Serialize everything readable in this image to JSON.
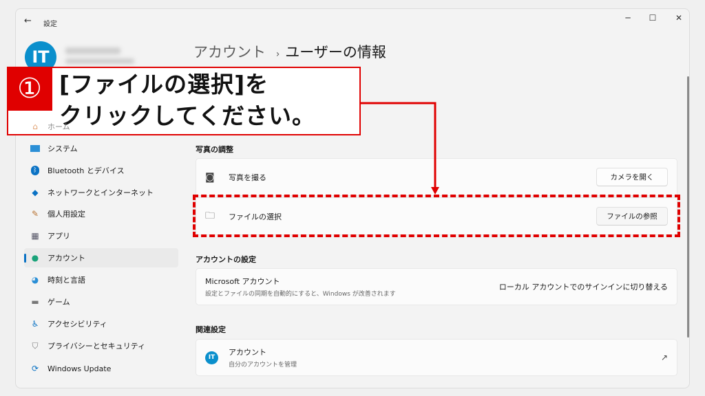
{
  "window": {
    "title": "設定",
    "back_icon": "arrow-left-icon",
    "controls": [
      "minimize",
      "maximize",
      "close"
    ]
  },
  "user": {
    "avatar_text": "IT",
    "avatar_color": "#0a8fcc"
  },
  "sidebar": {
    "items": [
      {
        "label": "ホーム",
        "icon": "home-icon"
      },
      {
        "label": "システム",
        "icon": "monitor-icon"
      },
      {
        "label": "Bluetooth とデバイス",
        "icon": "bluetooth-icon"
      },
      {
        "label": "ネットワークとインターネット",
        "icon": "wifi-icon"
      },
      {
        "label": "個人用設定",
        "icon": "brush-icon"
      },
      {
        "label": "アプリ",
        "icon": "apps-icon"
      },
      {
        "label": "アカウント",
        "icon": "person-icon",
        "selected": true
      },
      {
        "label": "時刻と言語",
        "icon": "globe-clock-icon"
      },
      {
        "label": "ゲーム",
        "icon": "gamepad-icon"
      },
      {
        "label": "アクセシビリティ",
        "icon": "accessibility-icon"
      },
      {
        "label": "プライバシーとセキュリティ",
        "icon": "shield-icon"
      },
      {
        "label": "Windows Update",
        "icon": "update-icon"
      }
    ]
  },
  "main": {
    "breadcrumb": {
      "parent": "アカウント",
      "separator": "›",
      "current": "ユーザーの情報"
    },
    "photo_section": {
      "title": "写真の調整",
      "rows": [
        {
          "label": "写真を撮る",
          "icon": "camera-icon",
          "button": "カメラを開く"
        },
        {
          "label": "ファイルの選択",
          "icon": "folder-icon",
          "button": "ファイルの参照"
        }
      ]
    },
    "account_section": {
      "title": "アカウントの設定",
      "row": {
        "label": "Microsoft アカウント",
        "description": "設定とファイルの同期を自動的にすると、Windows が改善されます",
        "link": "ローカル アカウントでのサインインに切り替える"
      }
    },
    "related_section": {
      "title": "関連設定",
      "row": {
        "label": "アカウント",
        "description": "自分のアカウントを管理",
        "icon": "external-link-icon"
      }
    }
  },
  "annotation": {
    "number": "①",
    "line1": "[ファイルの選択]を",
    "line2": "クリックしてください。",
    "color": "#e00000"
  }
}
